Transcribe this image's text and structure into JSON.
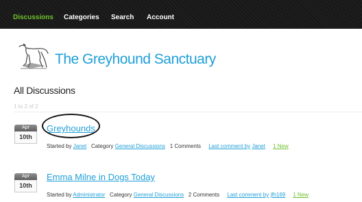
{
  "nav": {
    "items": [
      {
        "label": "Discussions",
        "active": true
      },
      {
        "label": "Categories",
        "active": false
      },
      {
        "label": "Search",
        "active": false
      },
      {
        "label": "Account",
        "active": false
      }
    ]
  },
  "site": {
    "title": "The Greyhound Sanctuary"
  },
  "discussions": {
    "heading": "All Discussions",
    "count": "1 to 2 of 2",
    "items": [
      {
        "month": "Apr",
        "day": "10th",
        "title": "Greyhounds",
        "started_label": "Started by",
        "author": "Janet",
        "category_label": "Category",
        "category": "General Discussions",
        "comments": "1 Comments",
        "last_comment_label": "Last comment by",
        "last_commenter": "Janet",
        "new_badge": "1 New"
      },
      {
        "month": "Apr",
        "day": "10th",
        "title": "Emma Milne in Dogs Today",
        "started_label": "Started by",
        "author": "Administrator",
        "category_label": "Category",
        "category": "General Discussions",
        "comments": "2 Comments",
        "last_comment_label": "Last comment by",
        "last_commenter": "jfh169",
        "new_badge": "1 New"
      }
    ]
  },
  "colors": {
    "accent": "#1e9fd8",
    "active_nav": "#6fc02e",
    "new_badge": "#6fc02e",
    "topbar": "#1c1c1c"
  },
  "icons": {
    "logo": "greyhound-logo-icon",
    "calendar": "calendar-icon"
  }
}
